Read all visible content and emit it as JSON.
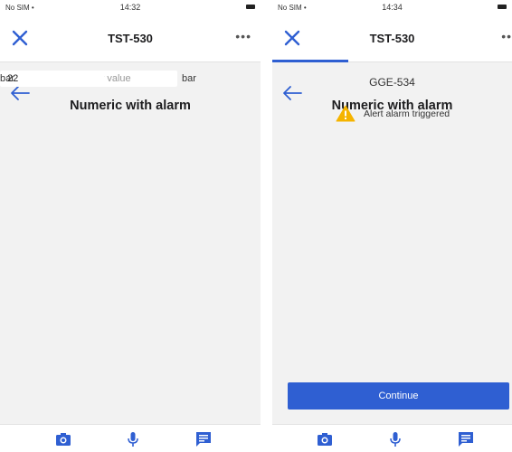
{
  "colors": {
    "accent": "#2f5fd2",
    "warning": "#f5b400",
    "background": "#f2f2f2"
  },
  "left_screen": {
    "status": {
      "carrier": "No SIM",
      "time": "14:32"
    },
    "navbar": {
      "close_icon": "close-icon",
      "title": "TST-530",
      "more_icon": "more-icon",
      "more": "•••"
    },
    "back_icon": "back-arrow-icon",
    "subtitle": "GGE-534",
    "heading": "Numeric with alarm",
    "input": {
      "value": "",
      "placeholder": "Enter value"
    },
    "unit": "bar",
    "toolbar_icons": [
      "camera-icon",
      "microphone-icon",
      "comment-icon"
    ]
  },
  "right_screen": {
    "status": {
      "carrier": "No SIM",
      "time": "14:34"
    },
    "navbar": {
      "close_icon": "close-icon",
      "title": "TST-530",
      "more_icon": "more-icon",
      "more": "•••"
    },
    "back_icon": "back-arrow-icon",
    "subtitle": "GGE-534",
    "heading": "Numeric with alarm",
    "input": {
      "value": "22",
      "placeholder": "Enter value"
    },
    "unit": "bar",
    "alert": {
      "icon": "warning-icon",
      "text": "Alert alarm triggered"
    },
    "continue_label": "Continue",
    "toolbar_icons": [
      "camera-icon",
      "microphone-icon",
      "comment-icon"
    ]
  }
}
